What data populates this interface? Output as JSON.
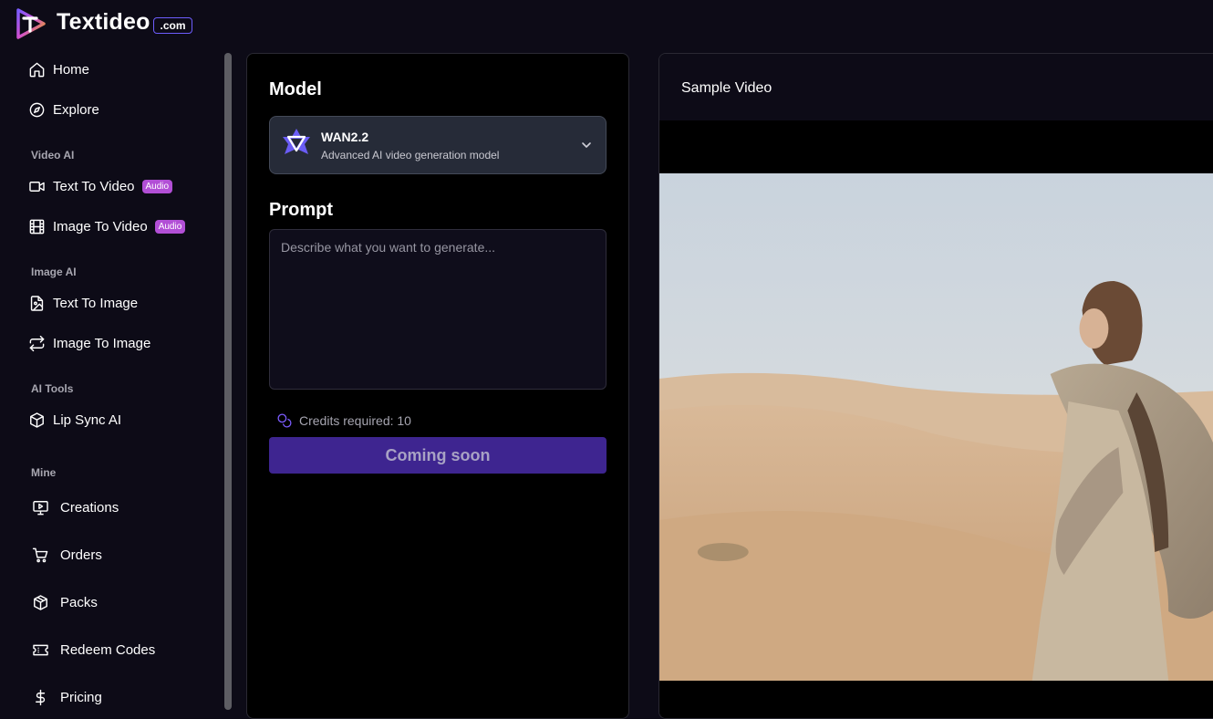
{
  "brand": {
    "name": "Textideo",
    "badge": ".com"
  },
  "sidebar": {
    "items": [
      {
        "label": "Home",
        "icon": "home-icon"
      },
      {
        "label": "Explore",
        "icon": "compass-icon"
      }
    ],
    "sections": [
      {
        "title": "Video AI",
        "items": [
          {
            "label": "Text To Video",
            "icon": "video-camera-icon",
            "badge": "Audio"
          },
          {
            "label": "Image To Video",
            "icon": "film-icon",
            "badge": "Audio"
          }
        ]
      },
      {
        "title": "Image AI",
        "items": [
          {
            "label": "Text To Image",
            "icon": "image-file-icon"
          },
          {
            "label": "Image To Image",
            "icon": "repeat-icon"
          }
        ]
      },
      {
        "title": "AI Tools",
        "items": [
          {
            "label": "Lip Sync AI",
            "icon": "cube-icon"
          }
        ]
      },
      {
        "title": "Mine",
        "items": [
          {
            "label": "Creations",
            "icon": "monitor-play-icon"
          },
          {
            "label": "Orders",
            "icon": "cart-icon"
          },
          {
            "label": "Packs",
            "icon": "package-icon"
          },
          {
            "label": "Redeem Codes",
            "icon": "ticket-icon"
          },
          {
            "label": "Pricing",
            "icon": "dollar-icon"
          }
        ]
      }
    ]
  },
  "form": {
    "model_heading": "Model",
    "model": {
      "name": "WAN2.2",
      "description": "Advanced AI video generation model"
    },
    "prompt_heading": "Prompt",
    "prompt_placeholder": "Describe what you want to generate...",
    "prompt_value": "",
    "credits_text": "Credits required: 10",
    "submit_label": "Coming soon"
  },
  "preview": {
    "title": "Sample Video"
  },
  "colors": {
    "background": "#0d0b17",
    "accent": "#3e2590",
    "badge": "#b24fd6",
    "select_bg": "#262b38"
  }
}
